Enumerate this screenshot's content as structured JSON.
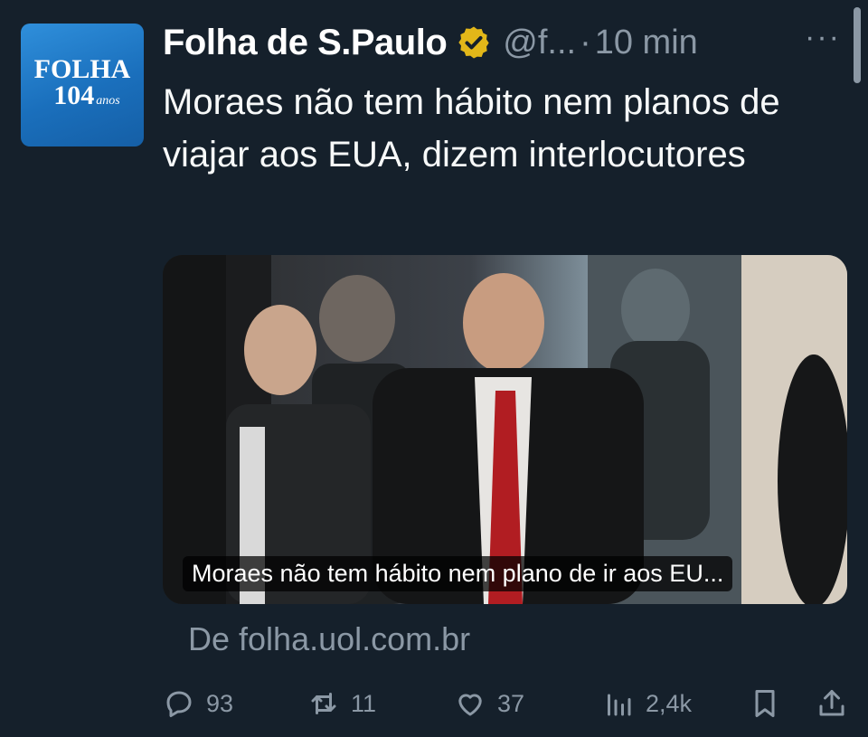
{
  "account": {
    "avatar": {
      "brand": "FOLHA",
      "years": "104",
      "years_suffix": "anos"
    },
    "name": "Folha de S.Paulo",
    "handle": "@f...",
    "separator": "·",
    "time": "10 min"
  },
  "more_label": "···",
  "tweet": {
    "text": "Moraes não tem hábito nem planos de viajar aos EUA, dizem interlocutores"
  },
  "link_card": {
    "caption": "Moraes não tem hábito nem plano de ir aos EU...",
    "source": "De folha.uol.com.br"
  },
  "actions": {
    "replies": "93",
    "retweets": "11",
    "likes": "37",
    "views": "2,4k"
  },
  "colors": {
    "background": "#15202b",
    "muted": "#8b98a5",
    "verified_gold": "#e2b719",
    "avatar_blue": "#1a6fbc"
  },
  "icons": [
    "verified-badge-icon",
    "more-options-icon",
    "reply-icon",
    "retweet-icon",
    "like-icon",
    "views-icon",
    "bookmark-icon",
    "share-icon"
  ]
}
